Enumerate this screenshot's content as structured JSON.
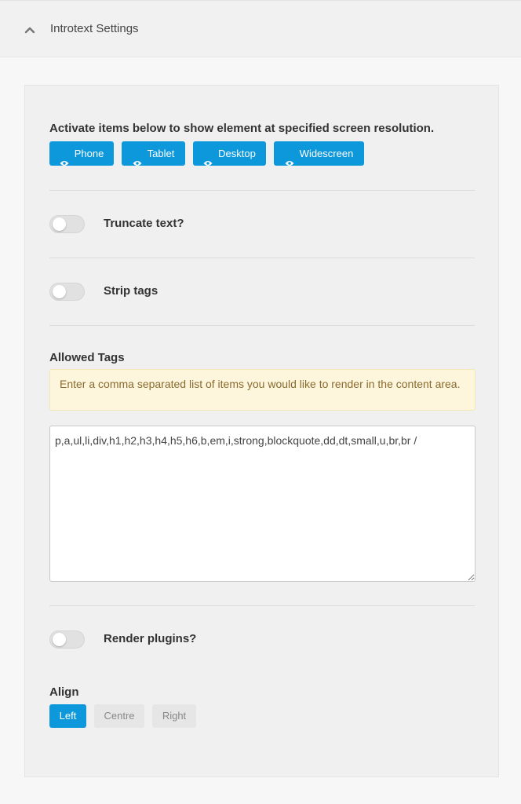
{
  "header": {
    "title": "Introtext Settings",
    "toggle_icon": "chevron-up-icon"
  },
  "devices": {
    "heading": "Activate items below to show element at specified screen resolution.",
    "buttons": [
      {
        "label": "Phone",
        "icon": "eye-icon"
      },
      {
        "label": "Tablet",
        "icon": "eye-icon"
      },
      {
        "label": "Desktop",
        "icon": "eye-icon"
      },
      {
        "label": "Widescreen",
        "icon": "eye-icon"
      }
    ],
    "color": "#0e98dc"
  },
  "toggles": {
    "truncate": {
      "label": "Truncate text?",
      "on": false
    },
    "strip_tags": {
      "label": "Strip tags",
      "on": false
    },
    "render_plugins": {
      "label": "Render plugins?",
      "on": false
    }
  },
  "allowed_tags": {
    "label": "Allowed Tags",
    "note": "Enter a comma separated list of items you would like to render in the content area.",
    "value": "p,a,ul,li,div,h1,h2,h3,h4,h5,h6,b,em,i,strong,blockquote,dd,dt,small,u,br,br /"
  },
  "align": {
    "label": "Align",
    "options": [
      "Left",
      "Centre",
      "Right"
    ],
    "selected": "Left"
  }
}
